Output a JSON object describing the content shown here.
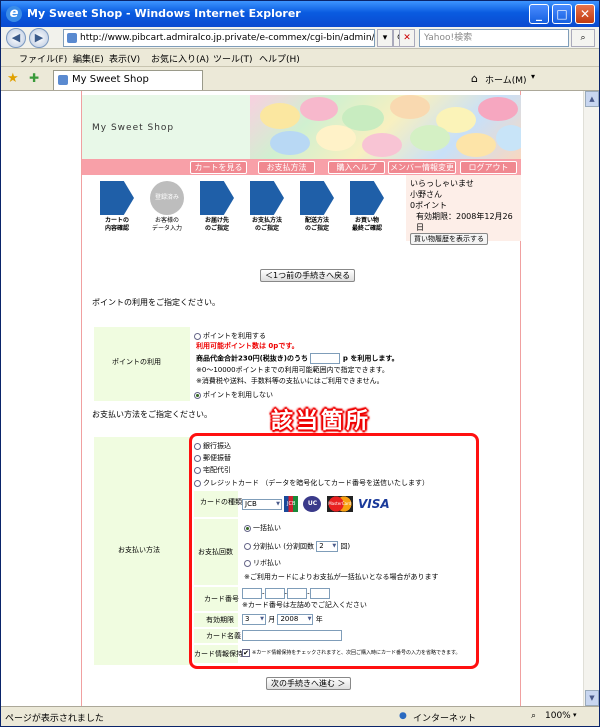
{
  "window": {
    "title": "My Sweet Shop - Windows Internet Explorer"
  },
  "address": {
    "url": "http://www.pibcart.admiralco.jp.private/e-commex/cgi-bin/admin/ex_sa",
    "search_placeholder": "Yahoo!検索"
  },
  "menu": [
    "ファイル(F)",
    "編集(E)",
    "表示(V)",
    "お気に入り(A)",
    "ツール(T)",
    "ヘルプ(H)"
  ],
  "tab": {
    "label": "My Sweet Shop"
  },
  "favbar": {
    "home": "ホーム(M)"
  },
  "shop": {
    "name": "My Sweet Shop"
  },
  "nav": [
    "カートを見る",
    "お支払方法",
    "購入ヘルプ",
    "メンバー情報変更",
    "ログアウト"
  ],
  "steps": [
    {
      "label": "カートの\n内容確認"
    },
    {
      "label": "お客様の\nデータ入力",
      "badge": "登録済み"
    },
    {
      "label": "お届け先\nのご指定"
    },
    {
      "label": "お支払方法\nのご指定"
    },
    {
      "label": "配送方法\nのご指定"
    },
    {
      "label": "お買い物\n最終ご確認"
    }
  ],
  "greeting": {
    "welcome": "いらっしゃいませ",
    "name": "小野さん",
    "points": "0ポイント",
    "expiry": "有効期限：2008年12月26日",
    "history_btn": "買い物履歴を表示する"
  },
  "back_btn": "＜1つ前の手続きへ戻る",
  "point": {
    "intro": "ポイントの利用をご指定ください。",
    "label": "ポイントの利用",
    "use": "ポイントを利用する",
    "available": "利用可能ポイント数は 0pです。",
    "total_prefix": "商品代金合計230円(税抜き)のうち",
    "total_suffix": "p を利用します。",
    "note1": "※0～10000ポイントまでの利用可能範囲内で指定できます。",
    "note2": "※消費税や送料、手数料等の支払いにはご利用できません。",
    "nouse": "ポイントを利用しない"
  },
  "payment": {
    "intro": "お支払い方法をご指定ください。",
    "label": "お支払い方法",
    "options": [
      "銀行振込",
      "郵便振替",
      "宅配代引",
      "クレジットカード （データを暗号化してカード番号を送信いたします）"
    ],
    "card_type_label": "カードの種類",
    "card_type_value": "JCB",
    "card_brands": [
      "JCB",
      "UC",
      "MasterCard",
      "VISA"
    ],
    "count_label": "お支払回数",
    "lump": "一括払い",
    "installment_prefix": "分割払い (分割回数",
    "installment_value": "2",
    "installment_suffix": "回)",
    "revolving": "リボ払い",
    "count_note": "※ご利用カードによりお支払が一括払いとなる場合があります",
    "number_label": "カード番号",
    "number_note": "※カード番号は左詰めでご記入ください",
    "expiry_label": "有効期限",
    "expiry_month": "3",
    "expiry_month_unit": "月",
    "expiry_year": "2008",
    "expiry_year_unit": "年",
    "holder_label": "カード名義",
    "keep_label": "カード情報保持",
    "keep_note": "※カード情報保持をチェックされますと、次回ご購入時にカード番号の入力を省略できます。"
  },
  "callout": "該当箇所",
  "next_btn": "次の手続きへ進む ＞",
  "status": {
    "left": "ページが表示されました",
    "zone": "インターネット",
    "zoom": "100%"
  }
}
